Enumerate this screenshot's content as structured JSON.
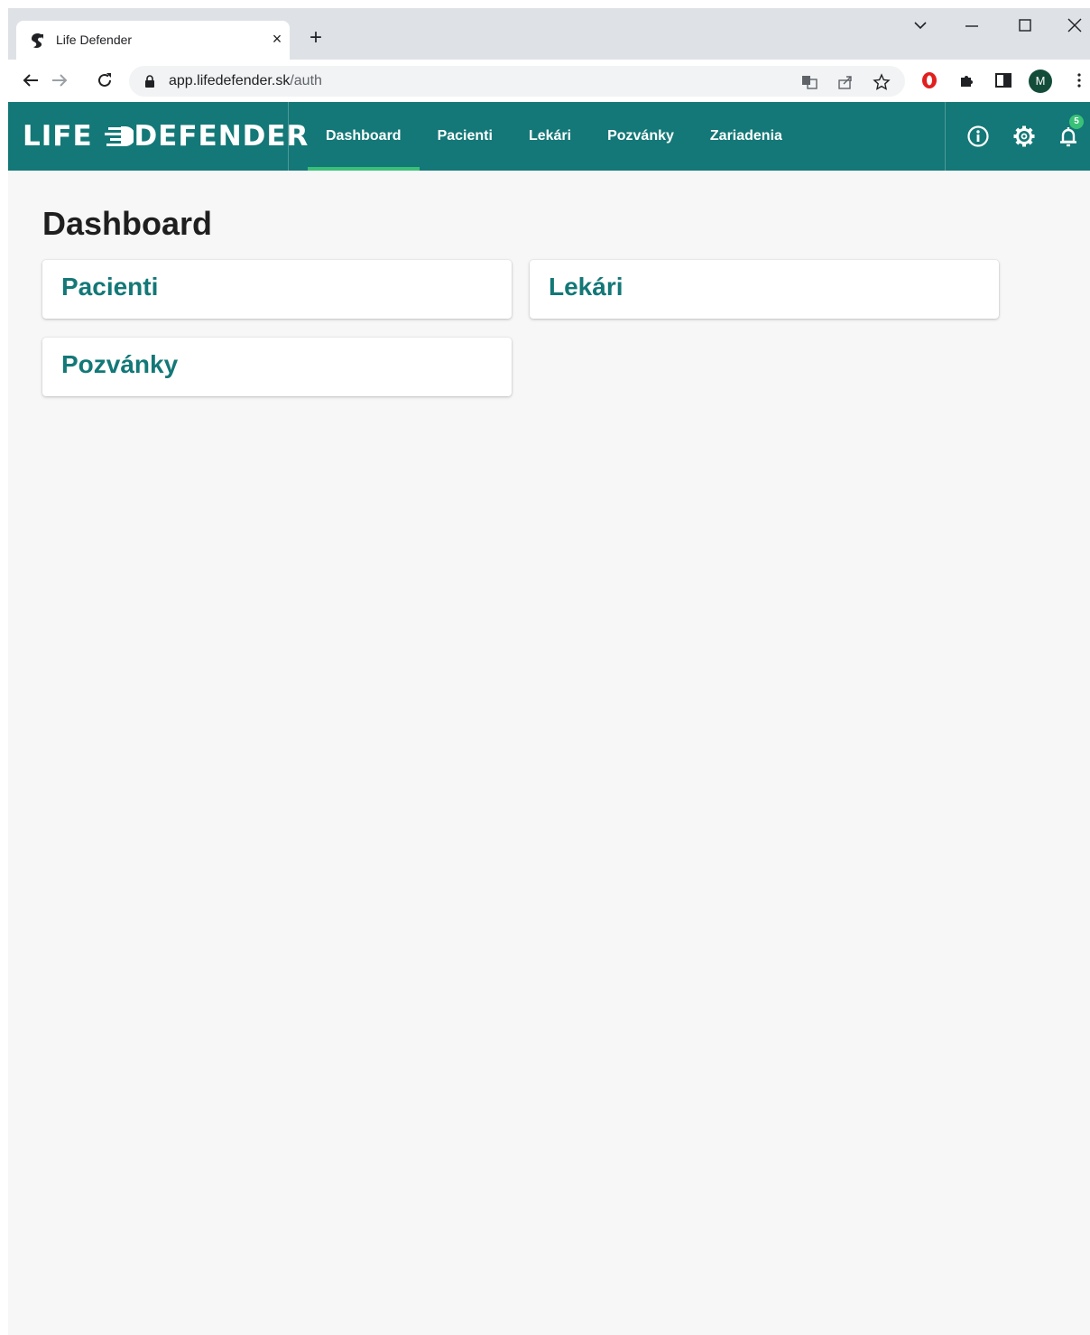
{
  "browser": {
    "tab_title": "Life Defender",
    "tab_close_glyph": "×",
    "new_tab_glyph": "+",
    "url_host": "app.lifedefender.sk",
    "url_path": "/auth",
    "profile_initial": "M"
  },
  "app": {
    "logo_left": "LIFE",
    "logo_right": "DEFENDER",
    "brand_color": "#137877",
    "accent_color": "#39c177",
    "nav": [
      {
        "label": "Dashboard",
        "active": true
      },
      {
        "label": "Pacienti",
        "active": false
      },
      {
        "label": "Lekári",
        "active": false
      },
      {
        "label": "Pozvánky",
        "active": false
      },
      {
        "label": "Zariadenia",
        "active": false
      }
    ],
    "header_icons": [
      "info-icon",
      "gear-icon",
      "bell-icon"
    ],
    "notification_count": "5"
  },
  "dashboard": {
    "title": "Dashboard",
    "cards": [
      {
        "label": "Pacienti"
      },
      {
        "label": "Lekári"
      },
      {
        "label": "Pozvánky"
      }
    ]
  }
}
